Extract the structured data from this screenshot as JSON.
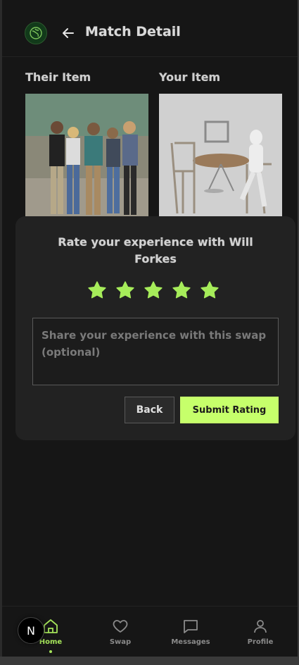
{
  "header": {
    "title": "Match Detail",
    "logo_icon": "globe-leaf-icon",
    "back_icon": "arrow-left-icon"
  },
  "items": {
    "their_label": "Their Item",
    "your_label": "Your Item"
  },
  "rating_modal": {
    "title": "Rate your experience with Will Forkes",
    "star_count": 5,
    "rating": 5,
    "star_color": "#a6ec5a",
    "feedback_placeholder": "Share your experience with this swap (optional)",
    "feedback_value": "",
    "back_label": "Back",
    "submit_label": "Submit Rating",
    "accent_color": "#c6ff6b"
  },
  "bottom_nav": {
    "items": [
      {
        "label": "Home",
        "icon": "home-icon",
        "active": true
      },
      {
        "label": "Swap",
        "icon": "heart-icon",
        "active": false
      },
      {
        "label": "Messages",
        "icon": "message-icon",
        "active": false
      },
      {
        "label": "Profile",
        "icon": "user-icon",
        "active": false
      }
    ]
  },
  "dev_badge": {
    "label": "N"
  }
}
